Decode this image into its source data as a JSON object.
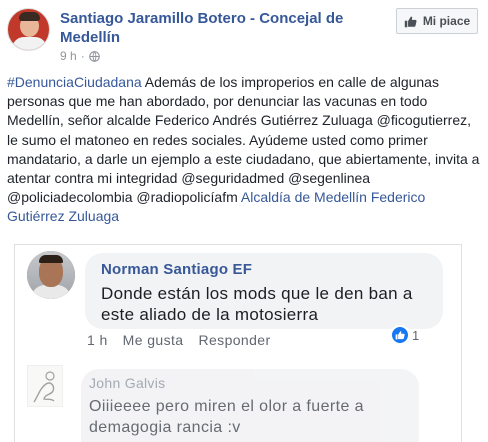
{
  "post": {
    "page_name": "Santiago Jaramillo Botero - Concejal de Medellín",
    "time": "9 h",
    "privacy_separator": "·",
    "like_page_label": "Mi piace",
    "text": {
      "hashtag": "#DenunciaCiudadana",
      "part1": " Además de los improperios en calle de algunas personas que me han abordado, por denunciar las vacunas en todo Medellín, señor alcalde Federico Andrés Gutiérrez Zuluaga @ficogutierrez, le sumo el matoneo en redes sociales. Ayúdeme usted como primer mandatario, a darle un ejemplo a este ciudadano, que abiertamente, invita a atentar contra mi integridad @seguridadmed @segenlinea @policiadecolombia @radiopolicíafm ",
      "link": "Alcaldía de Medellín Federico Gutiérrez Zuluaga"
    }
  },
  "comments": [
    {
      "author": "Norman Santiago EF",
      "text": "Donde están los mods que le den ban a este aliado de la motosierra",
      "time": "1 h",
      "like_label": "Me gusta",
      "reply_label": "Responder",
      "reaction_count": "1"
    },
    {
      "author": "John Galvis",
      "text": "Oiiieeee pero miren el olor a fuerte a demagogia rancia :v"
    }
  ],
  "colors": {
    "link_blue": "#365899",
    "reaction_blue": "#1877f2",
    "bubble_gray": "#f2f3f5"
  },
  "icons": [
    "globe-icon",
    "thumb-up-icon",
    "like-reaction-icon"
  ]
}
